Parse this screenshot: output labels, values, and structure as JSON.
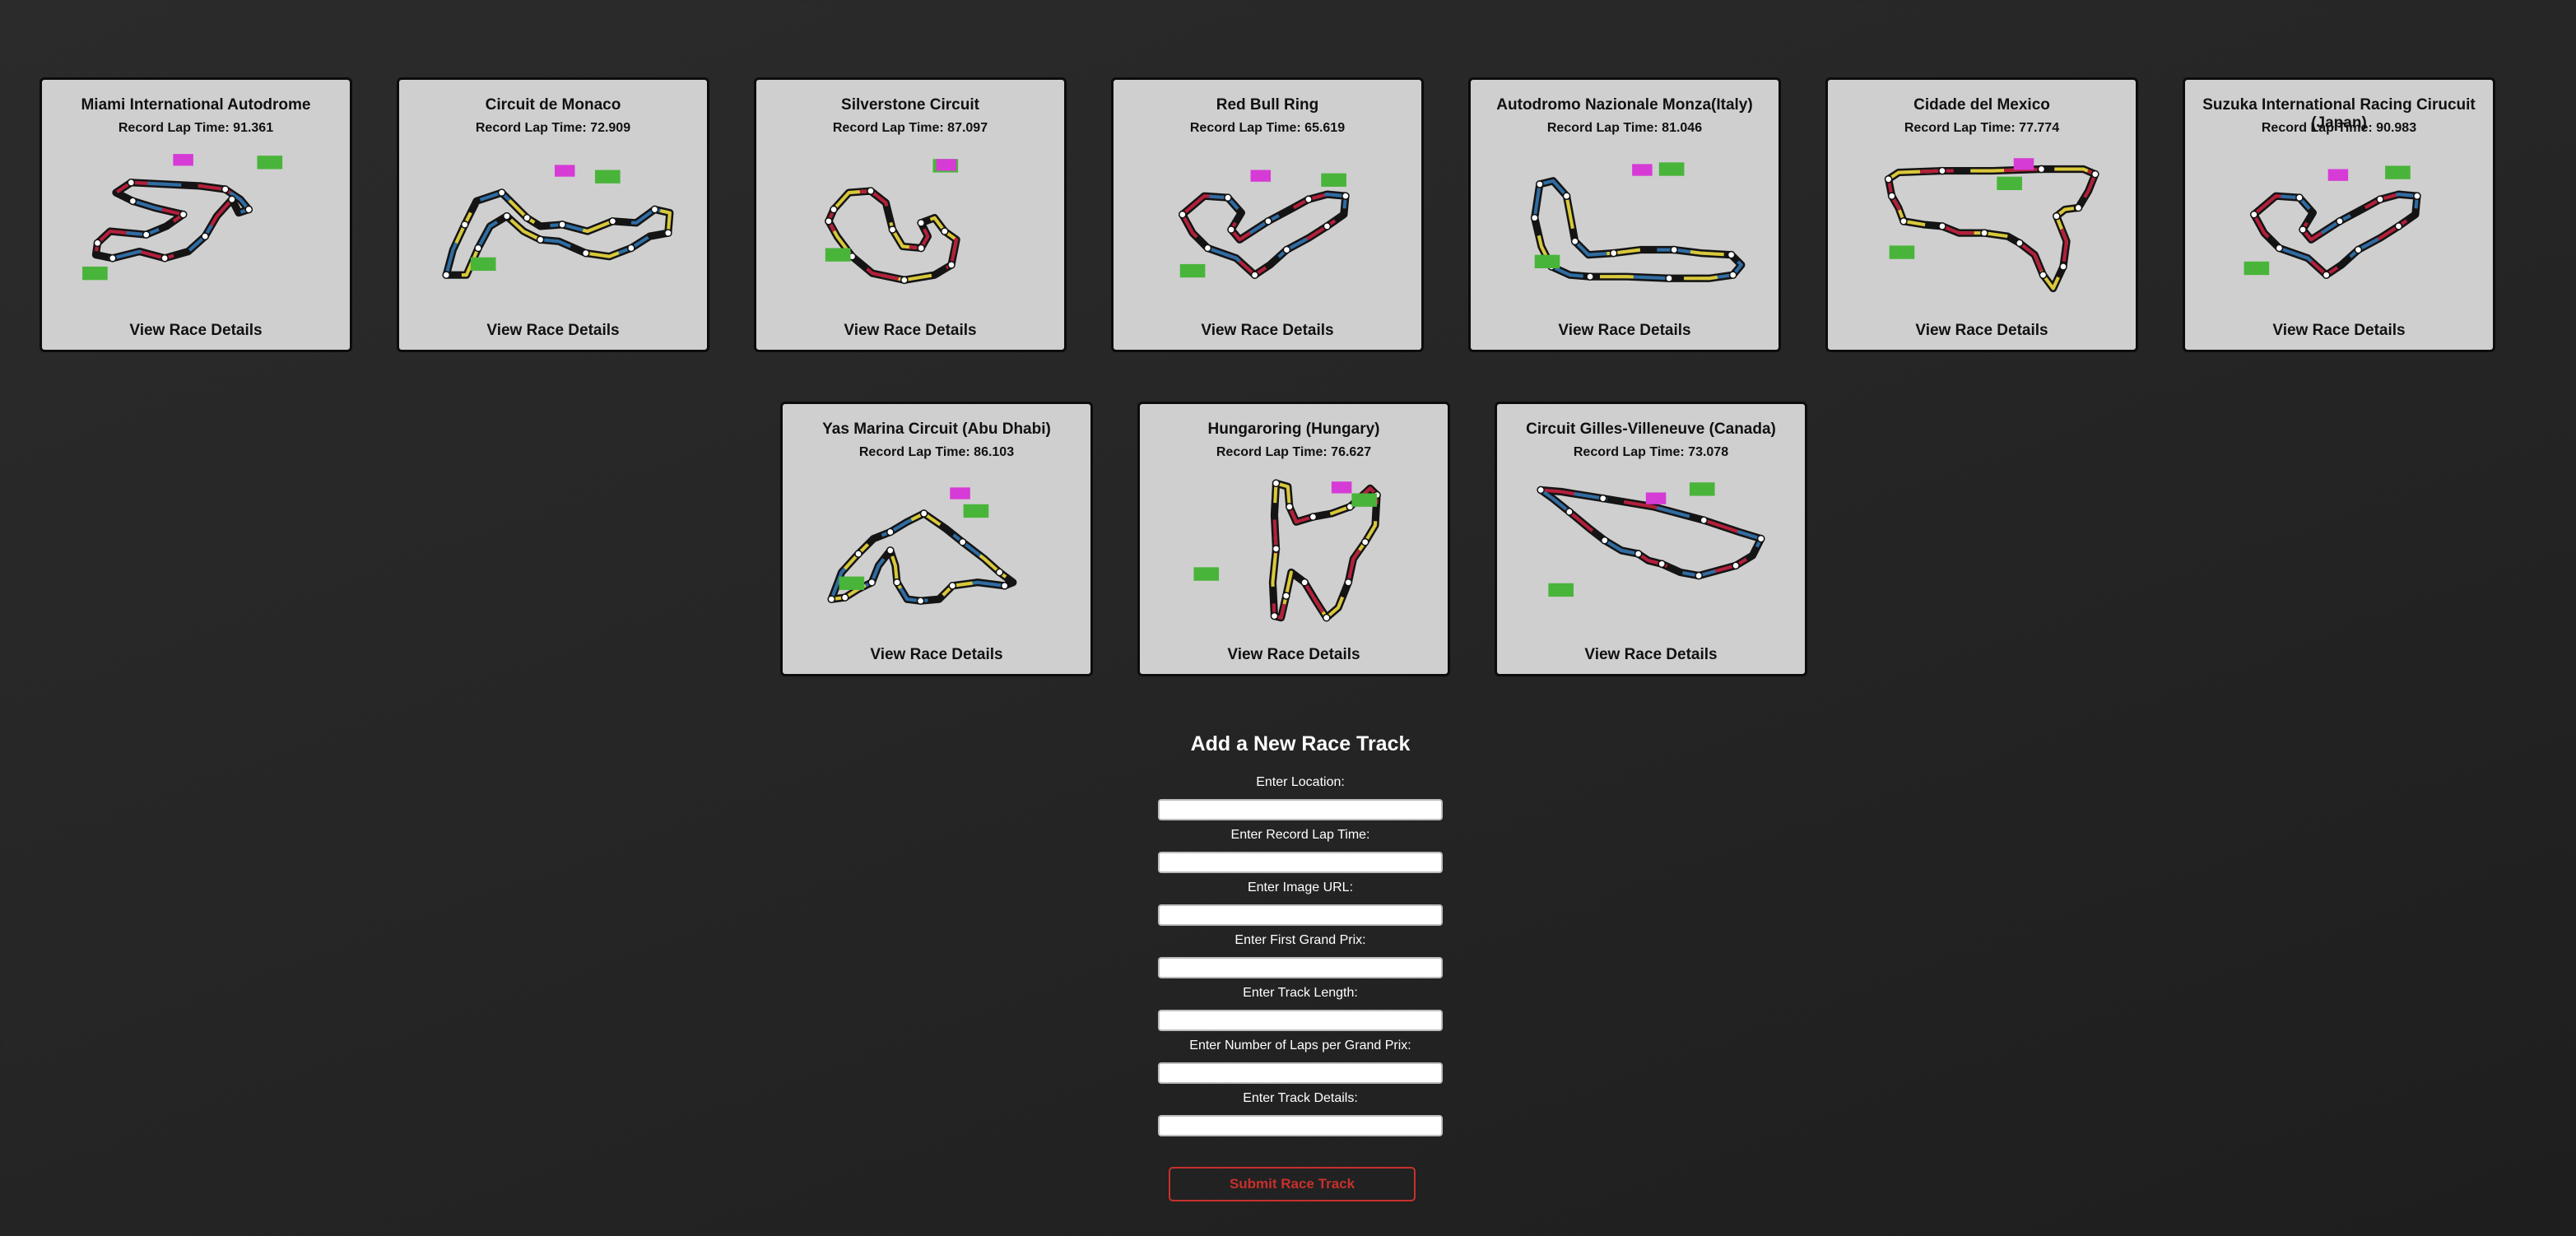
{
  "tracks": [
    {
      "name": "Miami International Autodrome",
      "record": "Record Lap Time: 91.361",
      "link": "View Race Details"
    },
    {
      "name": "Circuit de Monaco",
      "record": "Record Lap Time: 72.909",
      "link": "View Race Details"
    },
    {
      "name": "Silverstone Circuit",
      "record": "Record Lap Time: 87.097",
      "link": "View Race Details"
    },
    {
      "name": "Red Bull Ring",
      "record": "Record Lap Time: 65.619",
      "link": "View Race Details"
    },
    {
      "name": "Autodromo Nazionale Monza(Italy)",
      "record": "Record Lap Time: 81.046",
      "link": "View Race Details"
    },
    {
      "name": "Cidade del Mexico",
      "record": "Record Lap Time: 77.774",
      "link": "View Race Details"
    },
    {
      "name": "Suzuka International Racing Cirucuit (Japan)",
      "record": "Record Lap Time: 90.983",
      "link": "View Race Details"
    },
    {
      "name": "Yas Marina Circuit (Abu Dhabi)",
      "record": "Record Lap Time: 86.103",
      "link": "View Race Details"
    },
    {
      "name": "Hungaroring (Hungary)",
      "record": "Record Lap Time: 76.627",
      "link": "View Race Details"
    },
    {
      "name": "Circuit Gilles-Villeneuve (Canada)",
      "record": "Record Lap Time: 73.078",
      "link": "View Race Details"
    }
  ],
  "form": {
    "title": "Add a New Race Track",
    "labels": [
      "Enter Location:",
      "Enter Record Lap Time:",
      "Enter Image URL:",
      "Enter First Grand Prix:",
      "Enter Track Length:",
      "Enter Number of Laps per Grand Prix:",
      "Enter Track Details:"
    ],
    "submit": "Submit Race Track"
  },
  "colors": {
    "sector_red": "#b3203b",
    "sector_blue": "#2f6da3",
    "sector_yellow": "#d9c83a",
    "drs_zone": "#49b43a",
    "speed_trap": "#d63bd6",
    "submit_accent": "#c8302b"
  }
}
